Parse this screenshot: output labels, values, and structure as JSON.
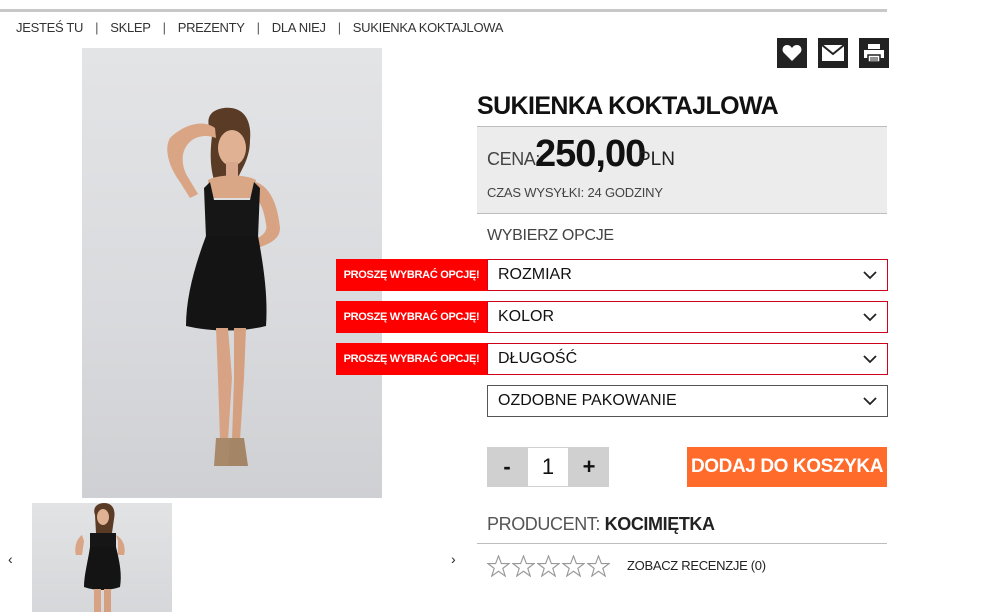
{
  "breadcrumb": [
    "JESTEŚ TU",
    "SKLEP",
    "PREZENTY",
    "DLA NIEJ",
    "SUKIENKA KOKTAJLOWA"
  ],
  "product": {
    "title": "SUKIENKA KOKTAJLOWA",
    "price_label": "CENA:",
    "price": "250,00",
    "currency": "PLN",
    "shipping": "CZAS WYSYŁKI: 24 GODZINY",
    "options_title": "WYBIERZ OPCJE",
    "error_text": "PROSZĘ WYBRAĆ OPCJĘ!",
    "options": {
      "size": "ROZMIAR",
      "color": "KOLOR",
      "length": "DŁUGOŚĆ",
      "packaging": "OZDOBNE PAKOWANIE"
    },
    "qty_minus": "-",
    "quantity": "1",
    "qty_plus": "+",
    "add_to_cart": "DODAJ DO KOSZYKA",
    "producer_label": "PRODUCENT:",
    "producer": "KOCIMIĘTKA",
    "rating_stars": 0,
    "reviews": "ZOBACZ RECENZJE (0)"
  },
  "gallery": {
    "prev": "‹",
    "next": "›"
  },
  "icons": [
    "heart-icon",
    "mail-icon",
    "print-icon"
  ],
  "colors": {
    "error": "#ff0000",
    "cta": "#ff6b2b",
    "icon_bg": "#222222",
    "price_bg": "#ececec"
  }
}
